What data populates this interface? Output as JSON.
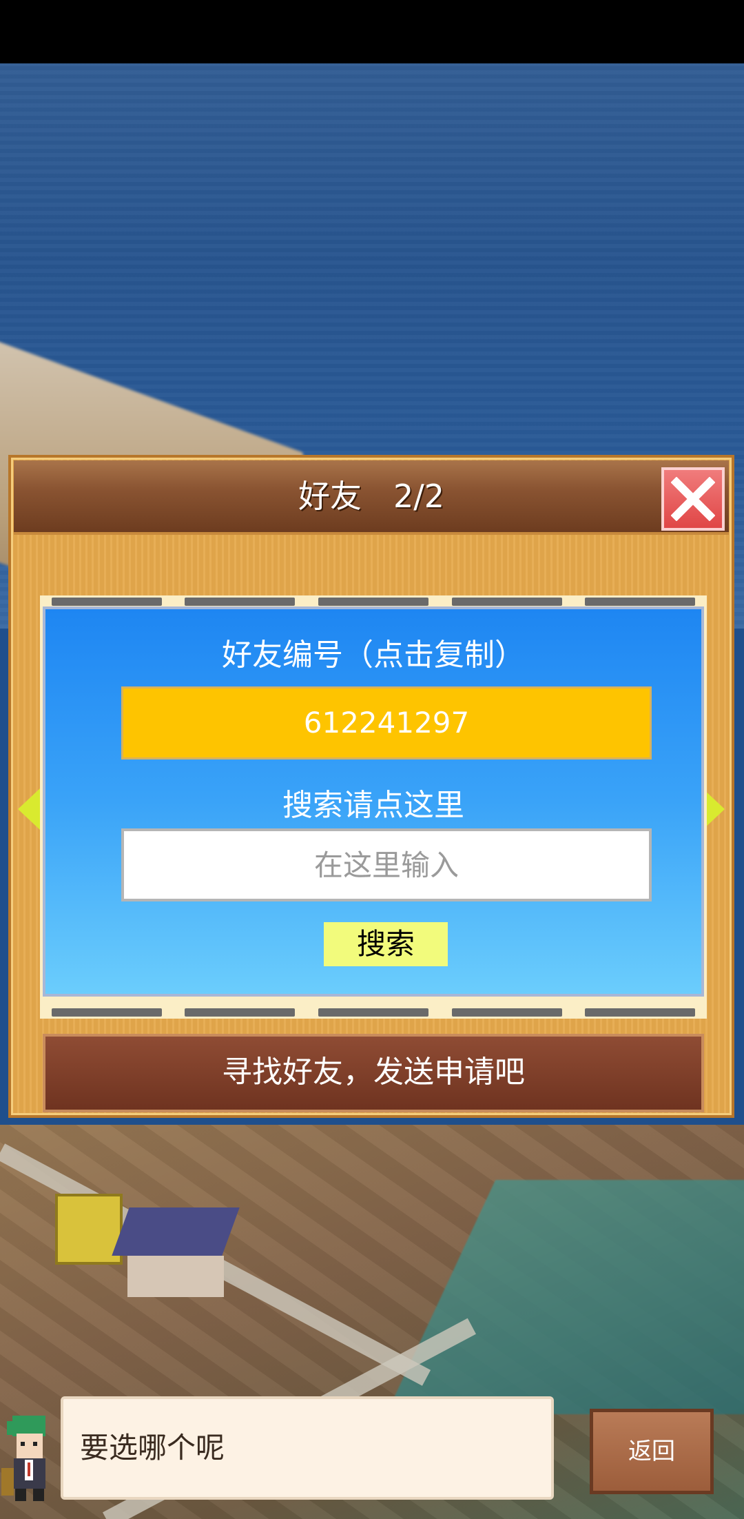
{
  "dialog": {
    "title": "好友　2/2",
    "close_icon": "close-icon"
  },
  "panel": {
    "friend_id_label": "好友编号（点击复制）",
    "friend_id_value": "612241297",
    "search_label": "搜索请点这里",
    "search_placeholder": "在这里输入",
    "search_button_label": "搜索"
  },
  "send_request_label": "寻找好友，发送申请吧",
  "bottom": {
    "speech_text": "要选哪个呢",
    "back_label": "返回"
  },
  "colors": {
    "panel_blue": "#1e86f2",
    "id_box_yellow": "#fec400",
    "search_button_yellow": "#f2fb7c",
    "close_red": "#e04646",
    "banner_brown": "#6f3320"
  }
}
